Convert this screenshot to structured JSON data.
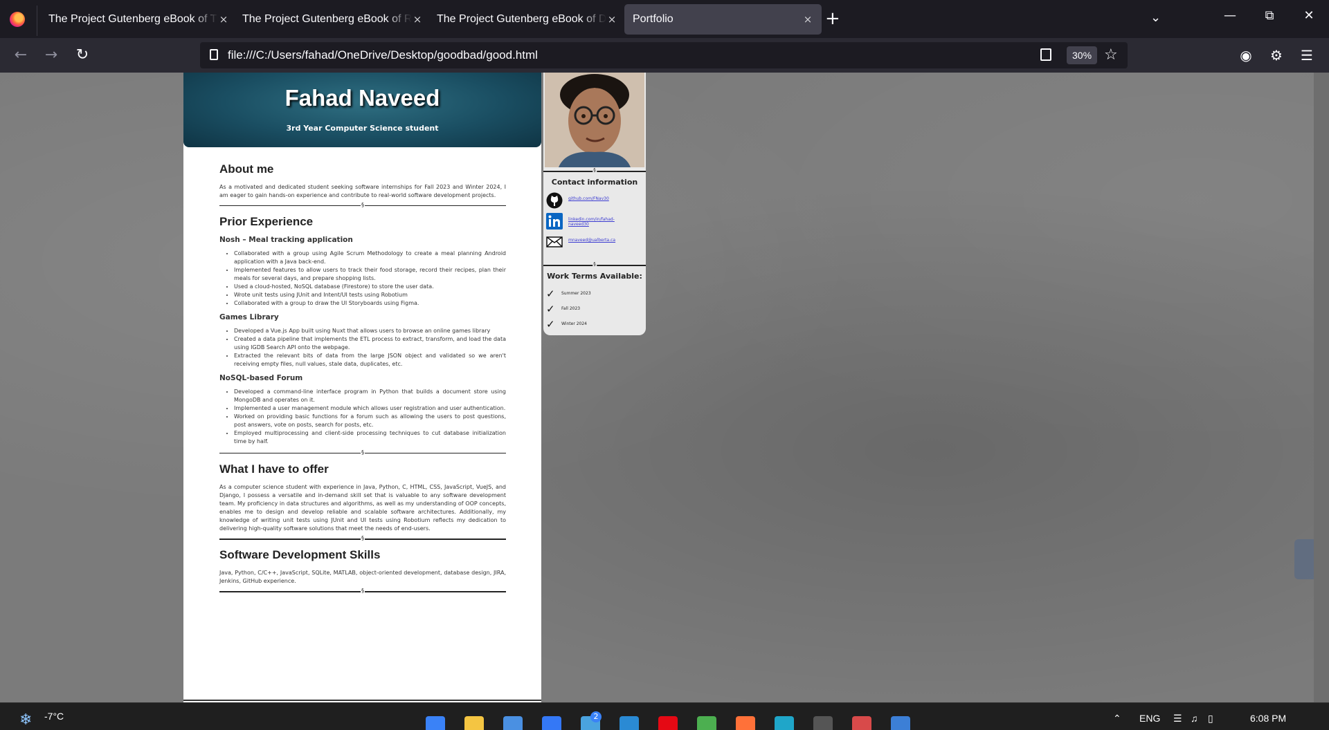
{
  "browser": {
    "tabs": [
      {
        "title": "The Project Gutenberg eBook of The Adventures of Sherlock Holmes",
        "active": false
      },
      {
        "title": "The Project Gutenberg eBook of Romeo and Juliet",
        "active": false
      },
      {
        "title": "The Project Gutenberg eBook of Dracula",
        "active": false
      },
      {
        "title": "Portfolio",
        "active": true
      }
    ],
    "url": "file:///C:/Users/fahad/OneDrive/Desktop/goodbad/good.html",
    "zoom": "30%",
    "new_tab_glyph": "+",
    "close_glyph": "×"
  },
  "resume": {
    "name": "Fahad Naveed",
    "subtitle": "3rd Year Computer Science student",
    "divider_mark": "§",
    "about": {
      "heading": "About me",
      "text": "As a motivated and dedicated student seeking software internships for Fall 2023 and Winter 2024, I am eager to gain hands-on experience and contribute to real-world software development projects."
    },
    "experience": {
      "heading": "Prior Experience",
      "projects": [
        {
          "title": "Nosh – Meal tracking application",
          "bullets": [
            "Collaborated with a group using Agile Scrum Methodology to create a meal planning Android application with a Java back-end.",
            "Implemented features to allow users to track their food storage, record their recipes, plan their meals for several days, and prepare shopping lists.",
            "Used a cloud-hosted, NoSQL database (Firestore) to store the user data.",
            "Wrote unit tests using JUnit and Intent/UI tests using Robotium",
            "Collaborated with a group to draw the UI Storyboards using Figma."
          ]
        },
        {
          "title": "Games Library",
          "bullets": [
            "Developed a Vue.js App built using Nuxt that allows users to browse an online games library",
            "Created a data pipeline that implements the ETL process to extract, transform, and load the data using IGDB Search API onto the webpage.",
            "Extracted the relevant bits of data from the large JSON object and validated so we aren't receiving empty files, null values, stale data, duplicates, etc."
          ]
        },
        {
          "title": "NoSQL-based Forum",
          "bullets": [
            "Developed a command-line interface program in Python that builds a document store using MongoDB and operates on it.",
            "Implemented a user management module which allows user registration and user authentication.",
            "Worked on providing basic functions for a forum such as allowing the users to post questions, post answers, vote on posts, search for posts, etc.",
            "Employed multiprocessing and client-side processing techniques to cut database initialization time by half."
          ]
        }
      ]
    },
    "offer": {
      "heading": "What I have to offer",
      "text": "As a computer science student with experience in Java, Python, C, HTML, CSS, JavaScript, VueJS, and Django, I possess a versatile and in-demand skill set that is valuable to any software development team. My proficiency in data structures and algorithms, as well as my understanding of OOP concepts, enables me to design and develop reliable and scalable software architectures. Additionally, my knowledge of writing unit tests using JUnit and UI tests using Robotium reflects my dedication to delivering high-quality software solutions that meet the needs of end-users."
    },
    "skills": {
      "heading": "Software Development Skills",
      "text": "Java, Python, C/C++, JavaScript, SQLite, MATLAB, object-oriented development, database design, JIRA, Jenkins, GitHub experience."
    }
  },
  "sidebar": {
    "contact_heading": "Contact information",
    "contacts": [
      {
        "icon": "github-icon",
        "text": "github.com/FNav30"
      },
      {
        "icon": "linkedin-icon",
        "text": "linkedin.com/in/fahad-naveed30"
      },
      {
        "icon": "mail-icon",
        "text": "mnaveed@ualberta.ca"
      }
    ],
    "work_terms_heading": "Work Terms Available:",
    "work_terms": [
      "Summer 2023",
      "Fall 2023",
      "Winter 2024"
    ]
  },
  "taskbar": {
    "temperature": "-7°C",
    "weather_sub": "Snow mode",
    "notification_badge": "2",
    "language": "ENG",
    "time": "6:08 PM"
  }
}
